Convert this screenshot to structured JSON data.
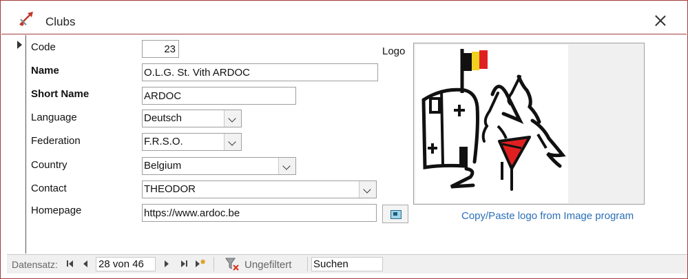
{
  "window": {
    "title": "Clubs"
  },
  "form": {
    "code": {
      "label": "Code",
      "value": "23"
    },
    "name": {
      "label": "Name",
      "value": "O.L.G. St. Vith ARDOC"
    },
    "short_name": {
      "label": "Short Name",
      "value": "ARDOC"
    },
    "language": {
      "label": "Language",
      "value": "Deutsch"
    },
    "federation": {
      "label": "Federation",
      "value": "F.R.S.O."
    },
    "country": {
      "label": "Country",
      "value": "Belgium"
    },
    "contact": {
      "label": "Contact",
      "value": "THEODOR"
    },
    "homepage": {
      "label": "Homepage",
      "value": "https://www.ardoc.be"
    }
  },
  "logo": {
    "label": "Logo",
    "paste_link": "Copy/Paste logo from Image program"
  },
  "navigation": {
    "label": "Datensatz:",
    "record": "28 von 46",
    "filter": "Ungefiltert",
    "search": "Suchen"
  },
  "colors": {
    "frame": "#a23a3a",
    "link": "#2a6fb5",
    "flag_red": "#e02020",
    "flag_yellow": "#f2d020"
  }
}
